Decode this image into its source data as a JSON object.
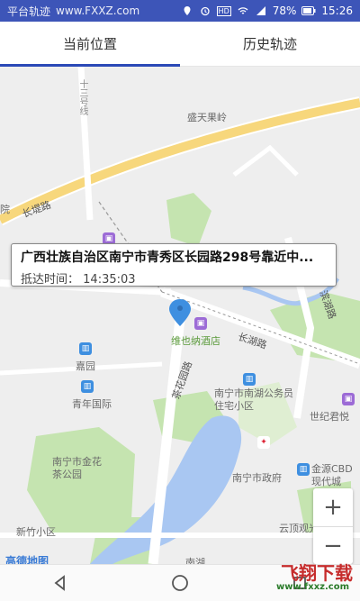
{
  "status_bar": {
    "left_text": "平台轨迹",
    "url_text": "www.FXXZ.com",
    "battery": "78%",
    "time": "15:26",
    "icons": [
      "location-icon",
      "alarm-icon",
      "hd-icon",
      "wifi-icon",
      "signal-icon",
      "battery-icon"
    ]
  },
  "tabs": [
    {
      "label": "当前位置",
      "active": true
    },
    {
      "label": "历史轨迹",
      "active": false
    }
  ],
  "map": {
    "roads": {
      "changdi": "长堤路",
      "changhu": "长湖路",
      "chahua": "茶花园路",
      "binhu": "滨湖路",
      "road13": "十三号线"
    },
    "places": {
      "shengtian": "盛天果岭",
      "jiayuan": "嘉园",
      "qingnian": "青年国际",
      "weiye": "维也纳酒店",
      "gongwuyuan": "南宁市南湖公务员住宅小区",
      "jinhua": "南宁市金花茶公园",
      "zhengfu": "南宁市政府",
      "jinyuan": "金源CBD现代城",
      "yunding": "云顶观光",
      "xinzhu": "新竹小区",
      "shiji": "世纪君悦",
      "nanhu": "南湖",
      "partial_left": "院"
    },
    "logo": "高德地图"
  },
  "bubble": {
    "address": "广西壮族自治区南宁市青秀区长园路298号靠近中...",
    "time_label": "抵达时间：",
    "time_value": "14:35:03"
  },
  "zoom": {
    "plus": "+",
    "minus": "−"
  },
  "watermark": {
    "main": "飞翔下载",
    "sub": "www.fxxz.com"
  },
  "colors": {
    "accent": "#2b49b7",
    "status_bar": "#3d55b8",
    "water": "#a9c7f2",
    "park": "#c5e4b0",
    "road_yellow": "#f7d77c"
  }
}
